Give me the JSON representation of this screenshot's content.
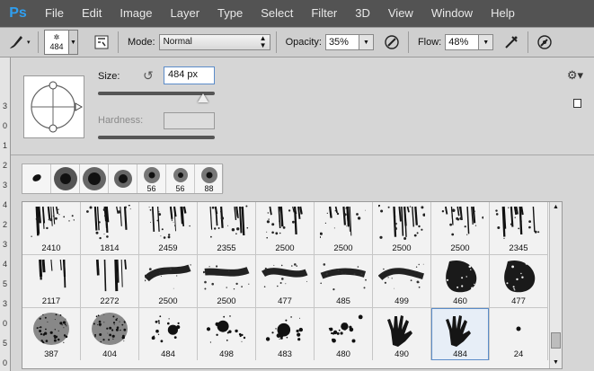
{
  "app": {
    "logo": "Ps"
  },
  "menu": [
    "File",
    "Edit",
    "Image",
    "Layer",
    "Type",
    "Select",
    "Filter",
    "3D",
    "View",
    "Window",
    "Help"
  ],
  "options_bar": {
    "brush_icon": "brush-icon",
    "brush_preset_size": "484",
    "mode_label": "Mode:",
    "mode_value": "Normal",
    "opacity_label": "Opacity:",
    "opacity_value": "35%",
    "flow_label": "Flow:",
    "flow_value": "48%"
  },
  "left_ruler": [
    "3",
    "0",
    "1",
    "2",
    "3",
    "4",
    "2",
    "3",
    "4",
    "5",
    "3",
    "0",
    "5",
    "0"
  ],
  "brush_panel": {
    "size_label": "Size:",
    "size_value": "484 px",
    "size_fraction": 0.9,
    "hardness_label": "Hardness:",
    "recent": [
      {
        "size": ""
      },
      {
        "size": ""
      },
      {
        "size": ""
      },
      {
        "size": ""
      },
      {
        "size": "56"
      },
      {
        "size": "56"
      },
      {
        "size": "88"
      }
    ],
    "grid": [
      {
        "size": "2410"
      },
      {
        "size": "1814"
      },
      {
        "size": "2459"
      },
      {
        "size": "2355"
      },
      {
        "size": "2500"
      },
      {
        "size": "2500"
      },
      {
        "size": "2500"
      },
      {
        "size": "2500"
      },
      {
        "size": "2345"
      },
      {
        "size": "2117"
      },
      {
        "size": "2272"
      },
      {
        "size": "2500"
      },
      {
        "size": "2500"
      },
      {
        "size": "477"
      },
      {
        "size": "485"
      },
      {
        "size": "499"
      },
      {
        "size": "460"
      },
      {
        "size": "477"
      },
      {
        "size": "387"
      },
      {
        "size": "404"
      },
      {
        "size": "484"
      },
      {
        "size": "498"
      },
      {
        "size": "483"
      },
      {
        "size": "480"
      },
      {
        "size": "490"
      },
      {
        "size": "484"
      },
      {
        "size": "24"
      }
    ],
    "selected_index": 25
  }
}
